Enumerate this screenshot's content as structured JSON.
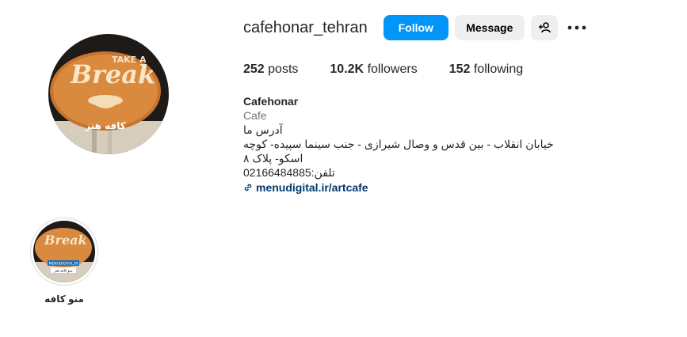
{
  "profile": {
    "username": "cafehonar_tehran",
    "follow_label": "Follow",
    "message_label": "Message",
    "avatar_sign_text_top": "TAKE A",
    "avatar_sign_text_main": "Break",
    "avatar_sign_text_fa": "کافه هنر"
  },
  "stats": {
    "posts_count": "252",
    "posts_label": "posts",
    "followers_count": "10.2K",
    "followers_label": "followers",
    "following_count": "152",
    "following_label": "following"
  },
  "bio": {
    "name": "Cafehonar",
    "category": "Cafe",
    "line1": "آدرس ما",
    "line2": "خیابان انقلاب - بین قدس و وصال شیرازی - جنب سینما سپیده- کوچه اسکو- پلاک ۸",
    "line3": "تلفن:02166484885",
    "link": "menudigital.ir/artcafe"
  },
  "highlights": [
    {
      "label": "منو کافه",
      "badge_top": "MENUDIGITAL.IR",
      "badge_bottom": "منو کافه هنر"
    }
  ],
  "icons": [
    "add-user-icon",
    "more-options-icon",
    "link-icon"
  ],
  "colors": {
    "follow": "#0095f6",
    "secondary_button": "#efefef",
    "link": "#00376b",
    "muted": "#737373"
  }
}
